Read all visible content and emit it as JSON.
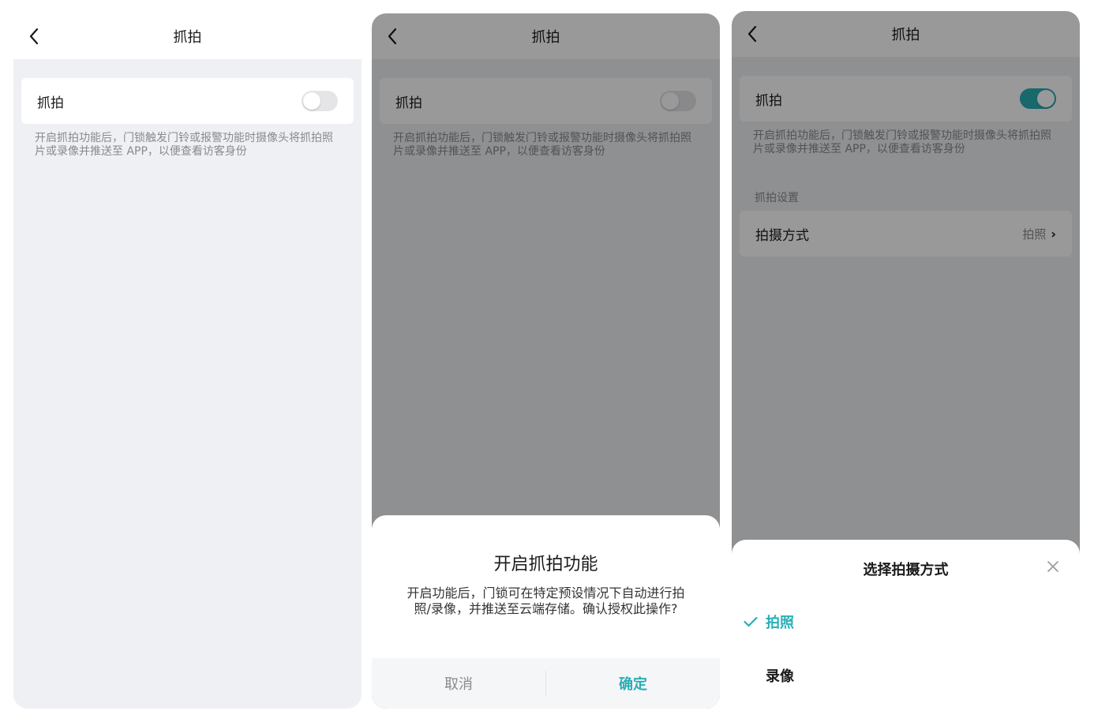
{
  "colors": {
    "accent": "#2aaeb5",
    "page_bg": "#eff0f4",
    "text_secondary": "#8a8a8e"
  },
  "screen1": {
    "nav": {
      "title": "抓拍",
      "back_icon": "chevron-left-icon"
    },
    "capture_row": {
      "label": "抓拍",
      "enabled": false
    },
    "description": "开启抓拍功能后，门锁触发门铃或报警功能时摄像头将抓拍照片或录像并推送至 APP，以便查看访客身份"
  },
  "screen2": {
    "nav": {
      "title": "抓拍",
      "back_icon": "chevron-left-icon"
    },
    "capture_row": {
      "label": "抓拍",
      "enabled": false
    },
    "description": "开启抓拍功能后，门锁触发门铃或报警功能时摄像头将抓拍照片或录像并推送至 APP，以便查看访客身份",
    "dialog": {
      "title": "开启抓拍功能",
      "message": "开启功能后，门锁可在特定预设情况下自动进行拍照/录像，并推送至云端存储。确认授权此操作?",
      "cancel_label": "取消",
      "confirm_label": "确定"
    }
  },
  "screen3": {
    "nav": {
      "title": "抓拍",
      "back_icon": "chevron-left-icon"
    },
    "capture_row": {
      "label": "抓拍",
      "enabled": true
    },
    "description": "开启抓拍功能后，门锁触发门铃或报警功能时摄像头将抓拍照片或录像并推送至 APP，以便查看访客身份",
    "section_label": "抓拍设置",
    "mode_row": {
      "label": "拍摄方式",
      "value": "拍照",
      "chevron": "›"
    },
    "sheet": {
      "title": "选择拍摄方式",
      "close_icon": "close-icon",
      "options": [
        {
          "label": "拍照",
          "selected": true
        },
        {
          "label": "录像",
          "selected": false
        }
      ]
    }
  }
}
